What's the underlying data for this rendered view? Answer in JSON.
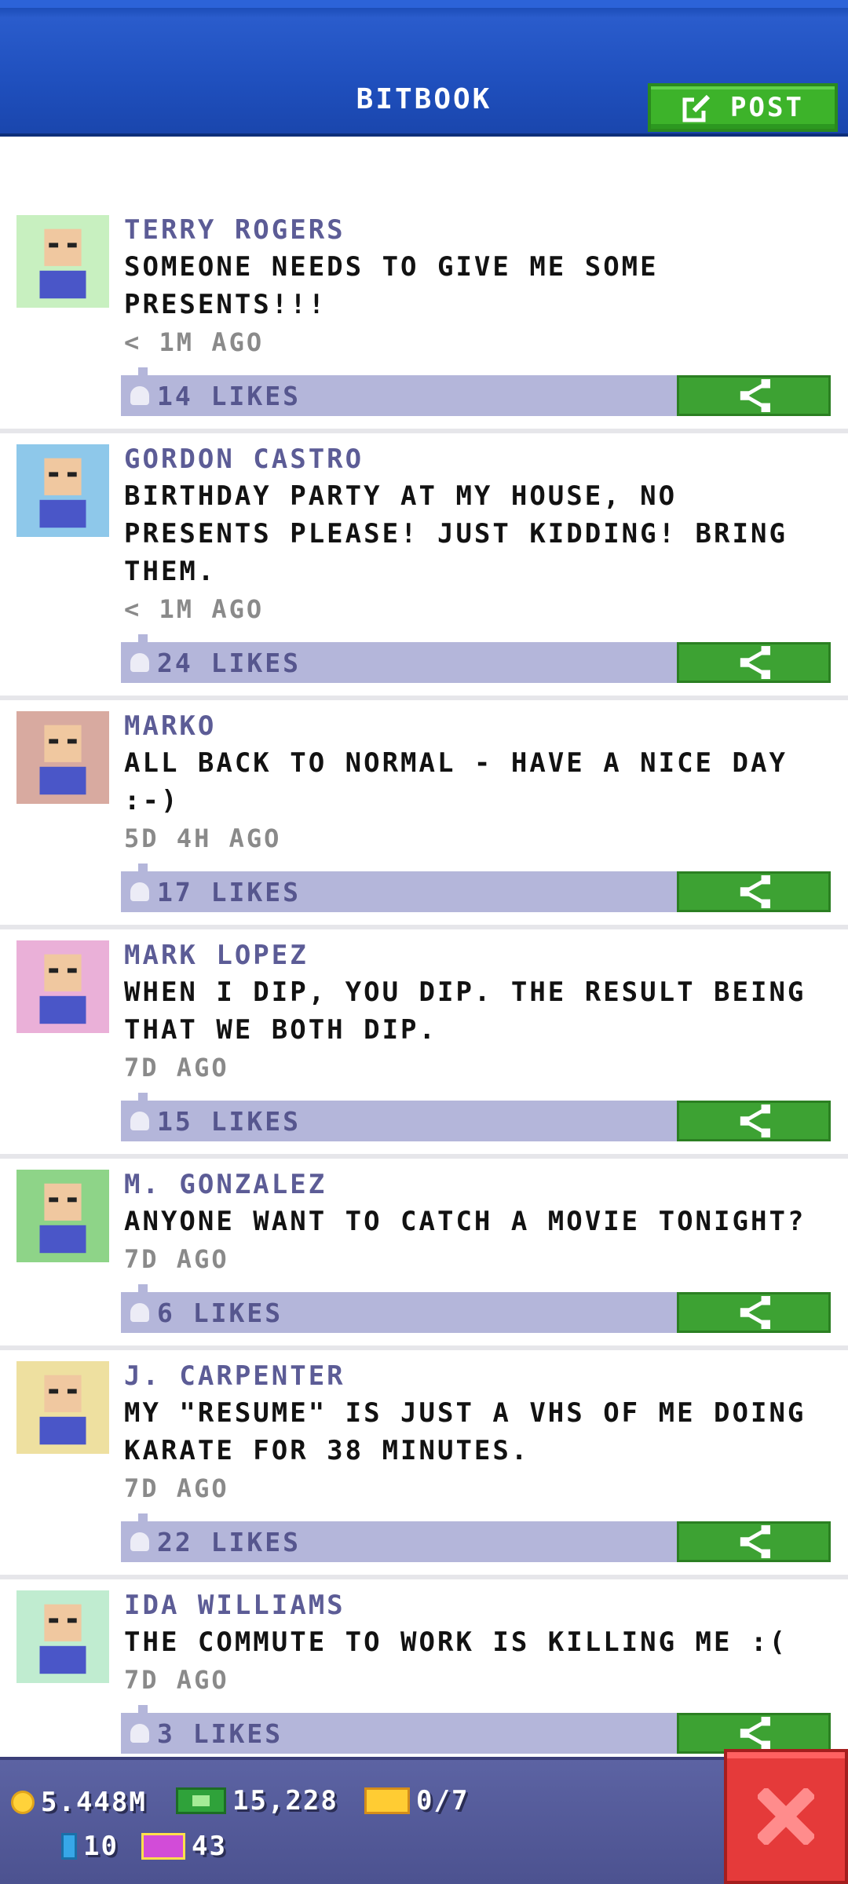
{
  "header": {
    "title": "BITBOOK",
    "post_label": "POST"
  },
  "posts": [
    {
      "name": "TERRY ROGERS",
      "message": "SOMEONE NEEDS TO GIVE ME SOME\nPRESENTS!!!",
      "time": "< 1M AGO",
      "likes": "14 LIKES",
      "avatar_bg": "#c8f0c0"
    },
    {
      "name": "GORDON CASTRO",
      "message": "BIRTHDAY PARTY AT MY HOUSE, NO\nPRESENTS PLEASE! JUST KIDDING! BRING\nTHEM.",
      "time": "< 1M AGO",
      "likes": "24 LIKES",
      "avatar_bg": "#8ec8ea"
    },
    {
      "name": "MARKO",
      "message": "ALL BACK TO NORMAL - HAVE A NICE DAY\n:-)",
      "time": "5D 4H AGO",
      "likes": "17 LIKES",
      "avatar_bg": "#d8aaa0"
    },
    {
      "name": "MARK LOPEZ",
      "message": "WHEN I DIP, YOU DIP. THE RESULT BEING\nTHAT WE BOTH DIP.",
      "time": "7D AGO",
      "likes": "15 LIKES",
      "avatar_bg": "#eab0d8"
    },
    {
      "name": "M. GONZALEZ",
      "message": "ANYONE WANT TO CATCH A MOVIE TONIGHT?",
      "time": "7D AGO",
      "likes": "6 LIKES",
      "avatar_bg": "#8ed488"
    },
    {
      "name": "J. CARPENTER",
      "message": "MY \"RESUME\" IS JUST A VHS OF ME DOING\nKARATE FOR 38 MINUTES.",
      "time": "7D AGO",
      "likes": "22 LIKES",
      "avatar_bg": "#eee0a0"
    },
    {
      "name": "IDA WILLIAMS",
      "message": "THE COMMUTE TO WORK IS KILLING ME :(",
      "time": "7D AGO",
      "likes": "3 LIKES",
      "avatar_bg": "#c0ecd0"
    }
  ],
  "footer": {
    "coins": "5.448M",
    "cash": "15,228",
    "tickets": "0/7",
    "bux": "10",
    "vip": "43"
  },
  "colors": {
    "header_blue": "#1f4fbd",
    "post_green": "#3db32a",
    "likes_bar": "#b4b6da",
    "name_purple": "#5c5c96",
    "close_red": "#e53a3a"
  },
  "icons": [
    "edit-icon",
    "like-icon",
    "share-icon",
    "coin-icon",
    "cash-icon",
    "ticket-icon",
    "bux-icon",
    "vip-icon",
    "close-icon"
  ]
}
